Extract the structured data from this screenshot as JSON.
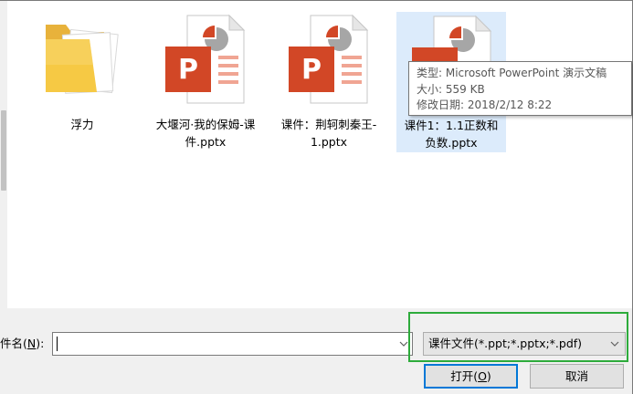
{
  "files": [
    {
      "name": "浮力",
      "type": "folder",
      "selected": false
    },
    {
      "name": "大堰河·我的保姆-课件.pptx",
      "type": "pptx",
      "selected": false
    },
    {
      "name": "课件：荆轲刺秦王-1.pptx",
      "type": "pptx",
      "selected": false
    },
    {
      "name": "课件1：1.1正数和负数.pptx",
      "type": "pptx",
      "selected": true
    }
  ],
  "tooltip": {
    "type_line": "类型: Microsoft PowerPoint 演示文稿",
    "size_line": "大小: 559 KB",
    "date_line": "修改日期: 2018/2/12 8:22"
  },
  "filename": {
    "label_prefix": "件名(",
    "label_accel": "N",
    "label_suffix": "):",
    "value": ""
  },
  "filter": {
    "selected": "课件文件(*.ppt;*.pptx;*.pdf)"
  },
  "buttons": {
    "open_prefix": "打开(",
    "open_accel": "O",
    "open_suffix": ")",
    "cancel": "取消"
  },
  "colors": {
    "selection": "#dcebfb",
    "highlight_border": "#2dab3b",
    "default_button_border": "#0078d7",
    "ppt_red": "#d24726",
    "folder": "#f6c944"
  }
}
